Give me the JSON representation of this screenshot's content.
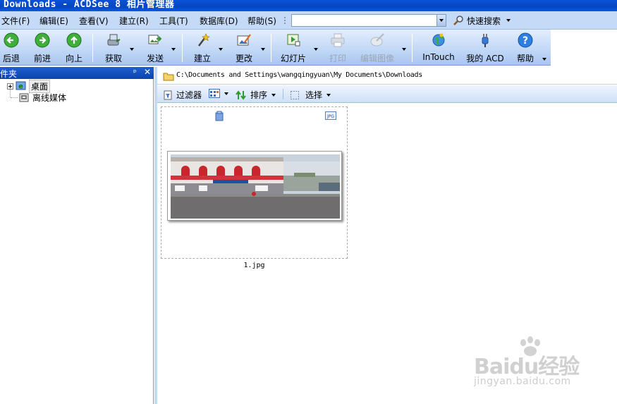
{
  "window": {
    "title": "Downloads - ACDSee 8 相片管理器"
  },
  "menu": {
    "items": [
      "文件(F)",
      "编辑(E)",
      "查看(V)",
      "建立(R)",
      "工具(T)",
      "数据库(D)",
      "帮助(S)"
    ],
    "search_value": "",
    "quick_search_label": "快速搜索"
  },
  "toolbar": {
    "buttons": [
      {
        "label": "后退",
        "icon": "back-arrow-icon"
      },
      {
        "label": "前进",
        "icon": "forward-arrow-icon"
      },
      {
        "label": "向上",
        "icon": "up-arrow-icon"
      },
      {
        "label": "获取",
        "icon": "acquire-icon"
      },
      {
        "label": "发送",
        "icon": "send-icon"
      },
      {
        "label": "建立",
        "icon": "create-wand-icon"
      },
      {
        "label": "更改",
        "icon": "modify-icon"
      },
      {
        "label": "幻灯片",
        "icon": "slideshow-icon"
      },
      {
        "label": "打印",
        "icon": "printer-icon"
      },
      {
        "label": "编辑图像",
        "icon": "edit-image-icon"
      },
      {
        "label": "InTouch",
        "icon": "intouch-globe-icon"
      },
      {
        "label": "我的 ACD",
        "icon": "my-acd-plug-icon"
      },
      {
        "label": "帮助",
        "icon": "help-icon"
      }
    ]
  },
  "left_panel": {
    "title": "件夹",
    "tree": [
      {
        "label": "桌面",
        "icon": "desktop-icon",
        "selected": true
      },
      {
        "label": "离线媒体",
        "icon": "offline-media-icon",
        "selected": false
      }
    ]
  },
  "address": {
    "path": "C:\\Documents and Settings\\wangqingyuan\\My Documents\\Downloads"
  },
  "sub_toolbar": {
    "filter_label": "过滤器",
    "sort_label": "排序",
    "select_label": "选择"
  },
  "files": [
    {
      "name": "1.jpg",
      "type_badge": "JPG"
    }
  ],
  "watermark": {
    "logo": "Baidu经验",
    "url": "jingyan.baidu.com"
  },
  "colors": {
    "titlebar": "#0a52d6",
    "menubar": "#c4daf7",
    "panel_header": "#1f5fd2"
  }
}
